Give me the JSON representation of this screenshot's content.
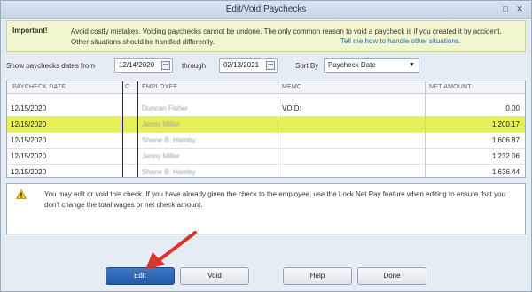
{
  "window": {
    "title": "Edit/Void Paychecks"
  },
  "banner": {
    "label": "Important!",
    "message": "Avoid costly mistakes. Voiding paychecks cannot be undone. The only common reason to void a paycheck is if you created it by accident. Other situations should be handled differently.",
    "link": "Tell me how to handle other situations."
  },
  "filters": {
    "show_label": "Show paychecks dates from",
    "from_date": "12/14/2020",
    "through_label": "through",
    "to_date": "02/13/2021",
    "sort_label": "Sort By",
    "sort_value": "Paycheck Date"
  },
  "table": {
    "headers": {
      "date": "PAYCHECK DATE",
      "check": "C...",
      "employee": "EMPLOYEE",
      "memo": "MEMO",
      "amount": "NET AMOUNT"
    },
    "rows": [
      {
        "date": "12/15/2020",
        "employee": "Duncan Fisher",
        "memo": "VOID:",
        "amount": "0.00"
      },
      {
        "date": "12/15/2020",
        "employee": "Jenny Miller",
        "memo": "",
        "amount": "1,200.17"
      },
      {
        "date": "12/15/2020",
        "employee": "Shane B. Hamby",
        "memo": "",
        "amount": "1,606.87"
      },
      {
        "date": "12/15/2020",
        "employee": "Jenny Miller",
        "memo": "",
        "amount": "1,232.06"
      },
      {
        "date": "12/15/2020",
        "employee": "Shane B. Hamby",
        "memo": "",
        "amount": "1,636.44"
      }
    ]
  },
  "notice": {
    "text": "You may edit or void this check. If you have already given the check to the employee, use the Lock Net Pay feature when editing to ensure that you don't change the total wages or net check amount."
  },
  "buttons": {
    "edit": "Edit",
    "void": "Void",
    "help": "Help",
    "done": "Done"
  },
  "colors": {
    "selected_row": "#e6ef57",
    "primary_button": "#2f66b8",
    "arrow": "#d9362b",
    "banner_bg": "#f2f6cf"
  }
}
